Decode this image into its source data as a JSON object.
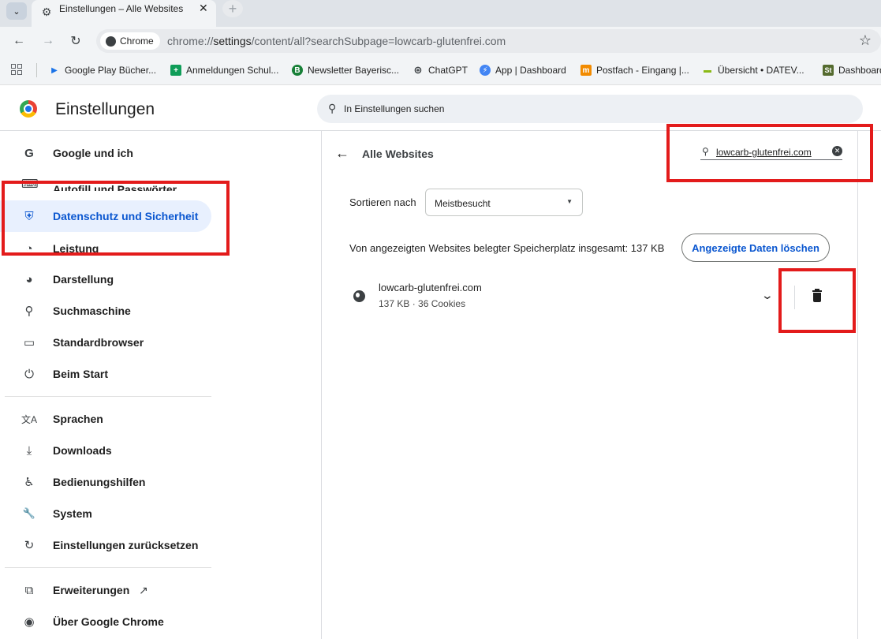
{
  "browser": {
    "tab_title": "Einstellungen – Alle Websites",
    "tab_close": "✕",
    "new_tab": "+",
    "chip_label": "Chrome",
    "url_prefix": "chrome://",
    "url_host": "settings",
    "url_path": "/content/all?searchSubpage=lowcarb-glutenfrei.com"
  },
  "bookmarks": [
    {
      "label": "Google Play Bücher...",
      "icon_color": "#1a73e8",
      "icon_glyph": "▶"
    },
    {
      "label": "Anmeldungen Schul...",
      "icon_color": "#0f9d58",
      "icon_glyph": "+"
    },
    {
      "label": "Newsletter Bayerisc...",
      "icon_color": "#188038",
      "icon_glyph": "B"
    },
    {
      "label": "ChatGPT",
      "icon_color": "#3c4043",
      "icon_glyph": "⊛"
    },
    {
      "label": "App | Dashboard",
      "icon_color": "#4285f4",
      "icon_glyph": "⚡"
    },
    {
      "label": "Postfach - Eingang |...",
      "icon_color": "#f28b00",
      "icon_glyph": "m"
    },
    {
      "label": "Übersicht • DATEV...",
      "icon_color": "#8ab916",
      "icon_glyph": "▬"
    },
    {
      "label": "Dashboard",
      "icon_color": "#556b2f",
      "icon_glyph": "St"
    }
  ],
  "settings": {
    "title": "Einstellungen",
    "search_placeholder": "In Einstellungen suchen"
  },
  "sidebar": {
    "items": [
      {
        "label": "Google und ich",
        "icon": "G"
      },
      {
        "label": "Autofill und Passwörter",
        "icon": "⌨"
      },
      {
        "label": "Datenschutz und Sicherheit",
        "icon": "⛨"
      },
      {
        "label": "Leistung",
        "icon": "◔"
      },
      {
        "label": "Darstellung",
        "icon": "◕"
      },
      {
        "label": "Suchmaschine",
        "icon": "⚲"
      },
      {
        "label": "Standardbrowser",
        "icon": "▭"
      },
      {
        "label": "Beim Start",
        "icon": "⏻"
      },
      {
        "label": "Sprachen",
        "icon": "文A"
      },
      {
        "label": "Downloads",
        "icon": "⤓"
      },
      {
        "label": "Bedienungshilfen",
        "icon": "♿"
      },
      {
        "label": "System",
        "icon": "🔧"
      },
      {
        "label": "Einstellungen zurücksetzen",
        "icon": "↻"
      },
      {
        "label": "Erweiterungen",
        "icon": "⧉"
      },
      {
        "label": "Über Google Chrome",
        "icon": "◉"
      }
    ],
    "external_icon": "↗"
  },
  "content": {
    "page_title": "Alle Websites",
    "site_search_value": "lowcarb-glutenfrei.com",
    "sort_label": "Sortieren nach",
    "sort_value": "Meistbesucht",
    "storage_text": "Von angezeigten Websites belegter Speicherplatz insgesamt: 137 KB",
    "clear_button": "Angezeigte Daten löschen",
    "sites": [
      {
        "name": "lowcarb-glutenfrei.com",
        "meta": "137 KB · 36 Cookies"
      }
    ]
  },
  "colors": {
    "accent": "#0b57d0",
    "active_nav_bg": "#e8f0fe",
    "highlight": "#e31b1b"
  }
}
